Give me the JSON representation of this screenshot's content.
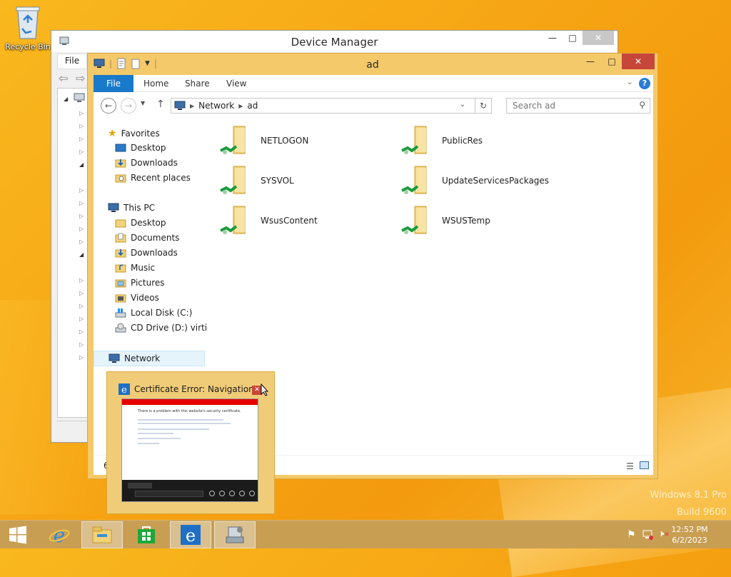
{
  "desktop": {
    "recycle_bin_label": "Recycle Bin",
    "watermark_line1": "Windows 8.1 Pro",
    "watermark_line2": "Build 9600"
  },
  "device_manager": {
    "title": "Device Manager",
    "menu_file": "File",
    "status_partial": "6"
  },
  "explorer": {
    "title": "ad",
    "ribbon_tabs": [
      "File",
      "Home",
      "Share",
      "View"
    ],
    "breadcrumb": [
      "Network",
      "ad"
    ],
    "search_placeholder": "Search ad",
    "nav": {
      "favorites": "Favorites",
      "fav_items": [
        "Desktop",
        "Downloads",
        "Recent places"
      ],
      "this_pc": "This PC",
      "pc_items": [
        "Desktop",
        "Documents",
        "Downloads",
        "Music",
        "Pictures",
        "Videos",
        "Local Disk (C:)",
        "CD Drive (D:) virtio-w"
      ],
      "network": "Network"
    },
    "folders": [
      "NETLOGON",
      "PublicRes",
      "SYSVOL",
      "UpdateServicesPackages",
      "WsusContent",
      "WSUSTemp"
    ]
  },
  "thumbnail": {
    "title": "Certificate Error: Navigation ...",
    "preview_heading": "There is a problem with this website's security certificate."
  },
  "taskbar": {
    "time": "12:52 PM",
    "date": "6/2/2023"
  }
}
